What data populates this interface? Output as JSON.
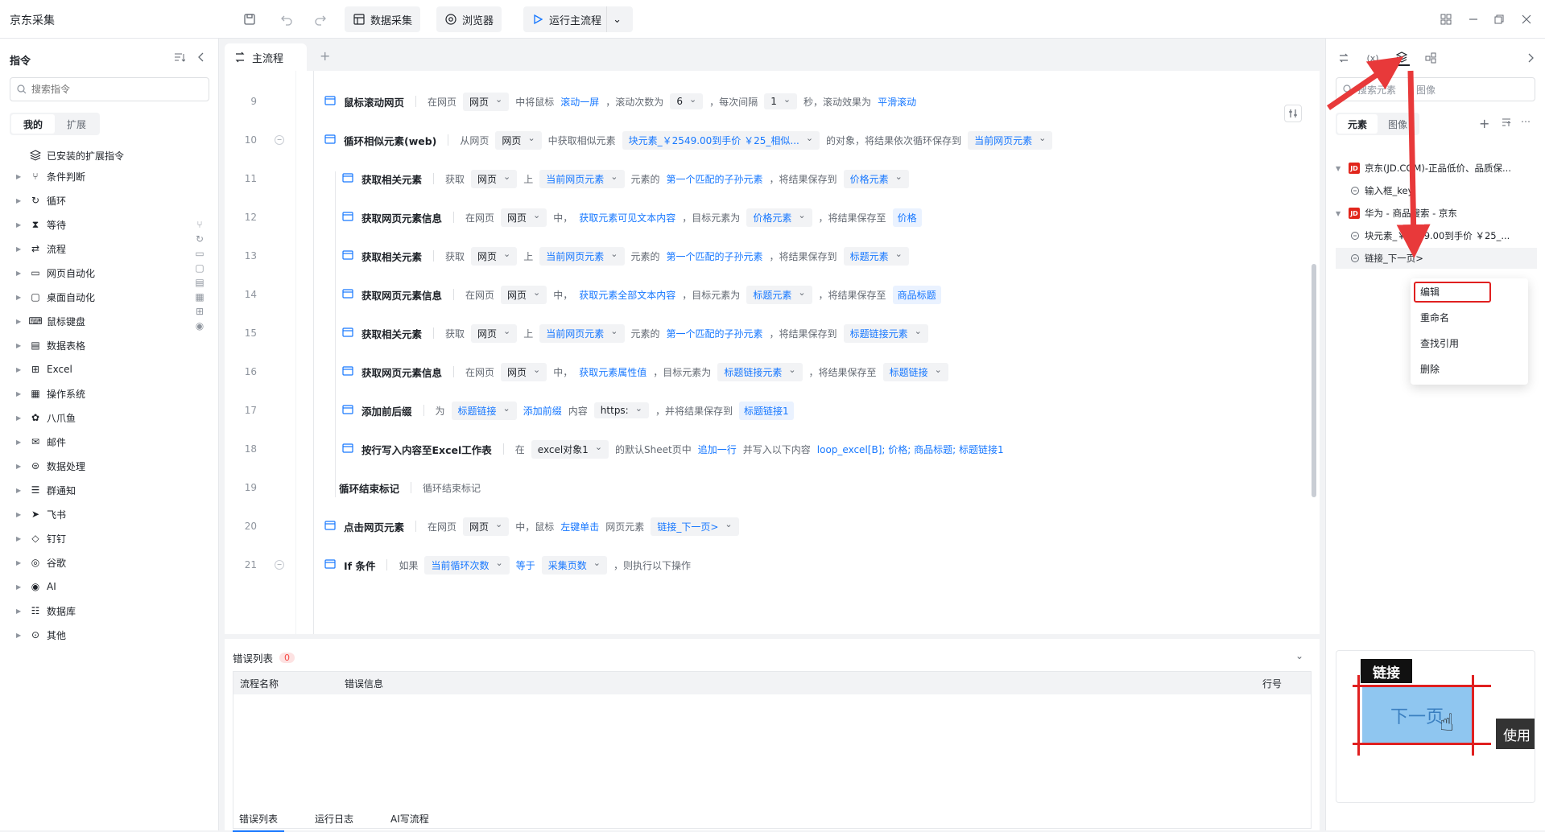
{
  "app": {
    "title": "京东采集"
  },
  "toolbar": {
    "data_collect": "数据采集",
    "browser": "浏览器",
    "run_main": "运行主流程"
  },
  "left": {
    "title": "指令",
    "search_placeholder": "搜索指令",
    "tabs": [
      "我的",
      "扩展"
    ],
    "installed": "已安装的扩展指令",
    "categories": [
      "条件判断",
      "循环",
      "等待",
      "流程",
      "网页自动化",
      "桌面自动化",
      "鼠标键盘",
      "数据表格",
      "Excel",
      "操作系统",
      "八爪鱼",
      "邮件",
      "数据处理",
      "群通知",
      "飞书",
      "钉钉",
      "谷歌",
      "AI",
      "数据库",
      "其他"
    ]
  },
  "tab": {
    "main": "主流程"
  },
  "rows": [
    {
      "ln": "9",
      "name": "鼠标滚动网页",
      "parts": [
        "在网页",
        "网页",
        "中将鼠标",
        "滚动一屏",
        "，滚动次数为",
        "6",
        "，每次间隔",
        "1",
        "秒，滚动效果为",
        "平滑滚动"
      ]
    },
    {
      "ln": "10",
      "name": "循环相似元素(web)",
      "parts": [
        "从网页",
        "网页",
        "中获取相似元素",
        "块元素_￥2549.00到手价 ￥25_相似...",
        "的对象，将结果依次循环保存到",
        "当前网页元素"
      ]
    },
    {
      "ln": "11",
      "name": "获取相关元素",
      "parts": [
        "获取",
        "网页",
        "上",
        "当前网页元素",
        "元素的",
        "第一个匹配的子孙元素",
        "，将结果保存到",
        "价格元素"
      ]
    },
    {
      "ln": "12",
      "name": "获取网页元素信息",
      "parts": [
        "在网页",
        "网页",
        "中，",
        "获取元素可见文本内容",
        "，目标元素为",
        "价格元素",
        "，将结果保存至",
        "价格"
      ]
    },
    {
      "ln": "13",
      "name": "获取相关元素",
      "parts": [
        "获取",
        "网页",
        "上",
        "当前网页元素",
        "元素的",
        "第一个匹配的子孙元素",
        "，将结果保存到",
        "标题元素"
      ]
    },
    {
      "ln": "14",
      "name": "获取网页元素信息",
      "parts": [
        "在网页",
        "网页",
        "中，",
        "获取元素全部文本内容",
        "，目标元素为",
        "标题元素",
        "，将结果保存至",
        "商品标题"
      ]
    },
    {
      "ln": "15",
      "name": "获取相关元素",
      "parts": [
        "获取",
        "网页",
        "上",
        "当前网页元素",
        "元素的",
        "第一个匹配的子孙元素",
        "，将结果保存到",
        "标题链接元素"
      ]
    },
    {
      "ln": "16",
      "name": "获取网页元素信息",
      "parts": [
        "在网页",
        "网页",
        "中，",
        "获取元素属性值",
        "，目标元素为",
        "标题链接元素",
        "，将结果保存至",
        "标题链接"
      ]
    },
    {
      "ln": "17",
      "name": "添加前后缀",
      "parts": [
        "为",
        "标题链接",
        "添加前缀",
        "内容",
        "https:",
        "，并将结果保存到",
        "标题链接1"
      ]
    },
    {
      "ln": "18",
      "name": "按行写入内容至Excel工作表",
      "parts": [
        "在",
        "excel对象1",
        "的默认Sheet页中",
        "追加一行",
        "并写入以下内容",
        "loop_excel[B]; 价格; 商品标题; 标题链接1"
      ]
    },
    {
      "ln": "19",
      "name": "循环结束标记",
      "parts": [
        "循环结束标记"
      ]
    },
    {
      "ln": "20",
      "name": "点击网页元素",
      "parts": [
        "在网页",
        "网页",
        "中，鼠标",
        "左键单击",
        "网页元素",
        "链接_下一页>"
      ]
    },
    {
      "ln": "21",
      "name": "If 条件",
      "parts": [
        "如果",
        "当前循环次数",
        "等于",
        "采集页数",
        "，则执行以下操作"
      ]
    }
  ],
  "errors": {
    "title": "错误列表",
    "count": "0",
    "columns": [
      "流程名称",
      "错误信息",
      "行号"
    ],
    "tabs": [
      "错误列表",
      "运行日志",
      "AI写流程"
    ]
  },
  "right": {
    "search_placeholder": "搜索元素",
    "search_image": "图像",
    "tabs": [
      "元素",
      "图像"
    ],
    "tree": [
      {
        "label": "京东(JD.COM)-正品低价、品质保...",
        "badge": "JD"
      },
      {
        "label": "输入框_key"
      },
      {
        "label": "华为 - 商品搜索 - 京东",
        "badge": "JD"
      },
      {
        "label": "块元素_￥2549.00到手价 ￥25_..."
      },
      {
        "label": "链接_下一页>"
      }
    ],
    "context_menu": [
      "编辑",
      "重命名",
      "查找引用",
      "删除"
    ],
    "preview": {
      "tag": "链接",
      "button": "下一页",
      "use": "使用"
    }
  },
  "colors": {
    "accent": "#1677ff",
    "jd": "#e1251b",
    "arrow": "#e8393a",
    "annotation": "#e02020"
  }
}
